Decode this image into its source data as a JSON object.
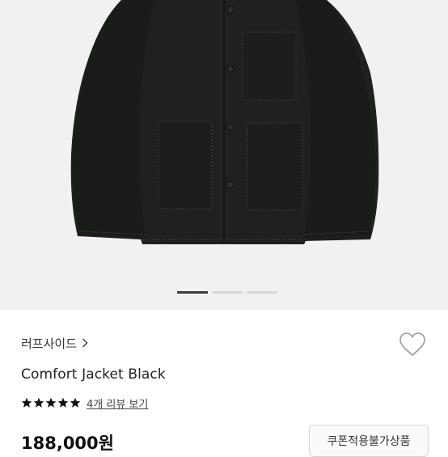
{
  "product": {
    "brand": "러프사이드",
    "name": "Comfort Jacket Black",
    "rating": 5,
    "reviews_label": "4개 리뷰 보기",
    "price": "188,000원",
    "coupon_badge": "쿠폰적용불가상품"
  },
  "gallery": {
    "slide_count": 3,
    "active_index": 0
  },
  "icons": {
    "brand_arrow": "chevron-right-icon",
    "wishlist": "heart-outline-icon",
    "rating": "star-icon"
  },
  "colors": {
    "star": "#111111",
    "image_background": "#f1f1f1",
    "jacket": "#1f211f"
  }
}
